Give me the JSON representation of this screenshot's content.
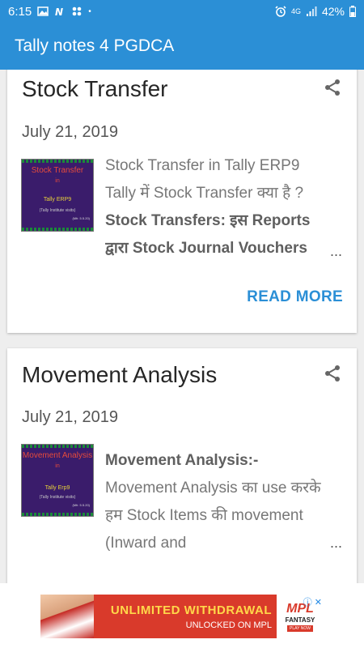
{
  "status_bar": {
    "time": "6:15",
    "battery": "42%",
    "network": "4G"
  },
  "app_bar": {
    "title": "Tally notes 4 PGDCA"
  },
  "posts": [
    {
      "title": "Stock Transfer",
      "date": "July 21, 2019",
      "thumb": {
        "line1": "Stock Transfer",
        "line2": "in",
        "line3": "Tally ERP9",
        "line4": "(Tally Institute visits)",
        "line5": "(Mfr. 5.5.20)"
      },
      "snippet_plain": "Stock Transfer in Tally ERP9 Tally में Stock Transfer क्या है ?",
      "snippet_bold": "Stock Transfers: इस Reports द्वारा Stock Journal Vouchers",
      "ellipsis": "...",
      "read_more": "READ MORE"
    },
    {
      "title": "Movement Analysis",
      "date": "July 21, 2019",
      "thumb": {
        "line1": "Movement Analysis",
        "line2": "in",
        "line3": "Tally Erp9",
        "line4": "(Tally Institute visits)",
        "line5": "(Mfr. 5.5.20)"
      },
      "snippet_bold": " Movement Analysis:-",
      "snippet_plain": "Movement Analysis का use करके हम Stock Items की movement (Inward and",
      "ellipsis": "..."
    }
  ],
  "ad": {
    "headline": "UNLIMITED WITHDRAWAL",
    "subline": "UNLOCKED ON MPL",
    "brand": "MPL",
    "brand_sub": "FANTASY",
    "cta": "PLAY NOW",
    "close": "ⓘ ✕"
  },
  "colors": {
    "primary": "#2b8fd6",
    "ad_red": "#d93a2b",
    "ad_yellow": "#ffd84a"
  }
}
